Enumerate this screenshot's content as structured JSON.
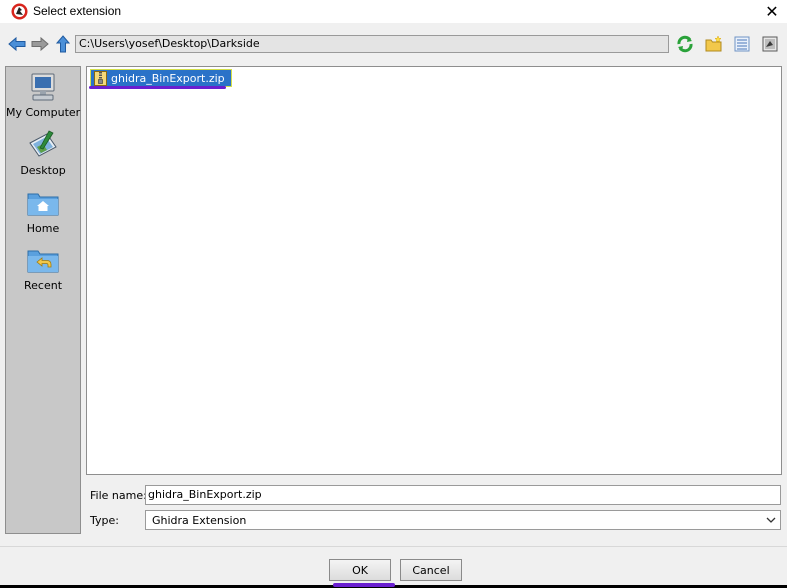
{
  "window": {
    "title": "Select extension",
    "close_glyph": "✕",
    "app_icon": "ghidra-dragon-icon"
  },
  "toolbar": {
    "back_icon": "arrow-left-icon",
    "forward_icon": "arrow-right-icon",
    "up_icon": "arrow-up-icon",
    "path": "C:\\Users\\yosef\\Desktop\\Darkside",
    "refresh_icon": "refresh-icon",
    "new_folder_icon": "new-folder-icon",
    "details_icon": "details-view-icon",
    "list_icon": "list-view-icon"
  },
  "sidebar": {
    "items": [
      {
        "label": "My Computer",
        "icon": "computer-icon"
      },
      {
        "label": "Desktop",
        "icon": "desktop-icon"
      },
      {
        "label": "Home",
        "icon": "home-folder-icon"
      },
      {
        "label": "Recent",
        "icon": "recent-folder-icon"
      }
    ]
  },
  "files": [
    {
      "name": "ghidra_BinExport.zip",
      "icon": "zip-file-icon",
      "selected": true
    }
  ],
  "form": {
    "filename_label": "File name:",
    "filename_value": "ghidra_BinExport.zip",
    "type_label": "Type:",
    "type_value": "Ghidra Extension"
  },
  "buttons": {
    "ok": "OK",
    "cancel": "Cancel"
  },
  "colors": {
    "selection": "#2a72c8",
    "highlight_underline": "#6a1fd0",
    "sidebar_bg": "#c8c8c8"
  }
}
